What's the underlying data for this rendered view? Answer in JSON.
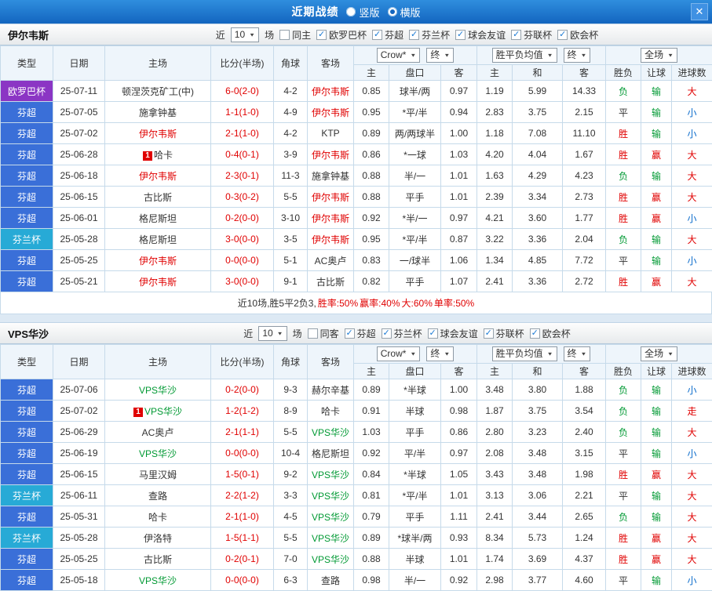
{
  "topbar": {
    "title": "近期战绩",
    "layout_options": [
      {
        "label": "竖版",
        "selected": false
      },
      {
        "label": "横版",
        "selected": true
      }
    ]
  },
  "icons": {
    "check": "✓",
    "dropdown_arrow": "▼",
    "close": "✕"
  },
  "columns": {
    "main": [
      "类型",
      "日期",
      "主场",
      "比分(半场)",
      "角球",
      "客场"
    ],
    "sub": [
      "主",
      "盘口",
      "客",
      "主",
      "和",
      "客",
      "胜负",
      "让球",
      "进球数"
    ],
    "odds_source": "Crow*",
    "odds_final": "终",
    "avg_label": "胜平负均值",
    "avg_final": "终",
    "scope": "全场"
  },
  "colors": {
    "score": "#e00000",
    "type": {
      "欧罗巴杯": "#8b35c4",
      "芬超": "#3a6fd8",
      "芬兰杯": "#27aad6"
    },
    "result": {
      "胜": "#e00000",
      "赢": "#e00000",
      "大": "#e00000",
      "走": "#e00000",
      "负": "#009933",
      "输": "#009933",
      "平": "#333333",
      "小": "#0b6bcb"
    }
  },
  "sections": [
    {
      "team": "伊尔韦斯",
      "focus_color": "#e00000",
      "filter": {
        "near": "近",
        "count": "10",
        "unit": "场",
        "venue": {
          "label": "同主",
          "checked": false
        },
        "competitions": [
          {
            "label": "欧罗巴杯",
            "checked": true
          },
          {
            "label": "芬超",
            "checked": true
          },
          {
            "label": "芬兰杯",
            "checked": true
          },
          {
            "label": "球会友谊",
            "checked": true
          },
          {
            "label": "芬联杯",
            "checked": true
          },
          {
            "label": "欧会杯",
            "checked": true
          }
        ]
      },
      "rows": [
        {
          "type": "欧罗巴杯",
          "date": "25-07-11",
          "home": "顿涅茨克矿工(中)",
          "score": "6-0(2-0)",
          "corner": "4-2",
          "away": "伊尔韦斯",
          "away_focus": true,
          "odds": [
            "0.85",
            "球半/两",
            "0.97"
          ],
          "avg": [
            "1.19",
            "5.99",
            "14.33"
          ],
          "res": [
            "负",
            "输",
            "大"
          ]
        },
        {
          "type": "芬超",
          "date": "25-07-05",
          "home": "施拿钟基",
          "score": "1-1(1-0)",
          "corner": "4-9",
          "away": "伊尔韦斯",
          "away_focus": true,
          "odds": [
            "0.95",
            "*平/半",
            "0.94"
          ],
          "avg": [
            "2.83",
            "3.75",
            "2.15"
          ],
          "res": [
            "平",
            "输",
            "小"
          ]
        },
        {
          "type": "芬超",
          "date": "25-07-02",
          "home": "伊尔韦斯",
          "home_focus": true,
          "score": "2-1(1-0)",
          "corner": "4-2",
          "away": "KTP",
          "odds": [
            "0.89",
            "两/两球半",
            "1.00"
          ],
          "avg": [
            "1.18",
            "7.08",
            "11.10"
          ],
          "res": [
            "胜",
            "输",
            "小"
          ]
        },
        {
          "type": "芬超",
          "date": "25-06-28",
          "home": "哈卡",
          "home_badge": "1",
          "score": "0-4(0-1)",
          "corner": "3-9",
          "away": "伊尔韦斯",
          "away_focus": true,
          "odds": [
            "0.86",
            "*一球",
            "1.03"
          ],
          "avg": [
            "4.20",
            "4.04",
            "1.67"
          ],
          "res": [
            "胜",
            "赢",
            "大"
          ]
        },
        {
          "type": "芬超",
          "date": "25-06-18",
          "home": "伊尔韦斯",
          "home_focus": true,
          "score": "2-3(0-1)",
          "corner": "11-3",
          "away": "施拿钟基",
          "odds": [
            "0.88",
            "半/一",
            "1.01"
          ],
          "avg": [
            "1.63",
            "4.29",
            "4.23"
          ],
          "res": [
            "负",
            "输",
            "大"
          ]
        },
        {
          "type": "芬超",
          "date": "25-06-15",
          "home": "古比斯",
          "score": "0-3(0-2)",
          "corner": "5-5",
          "away": "伊尔韦斯",
          "away_focus": true,
          "odds": [
            "0.88",
            "平手",
            "1.01"
          ],
          "avg": [
            "2.39",
            "3.34",
            "2.73"
          ],
          "res": [
            "胜",
            "赢",
            "大"
          ]
        },
        {
          "type": "芬超",
          "date": "25-06-01",
          "home": "格尼斯坦",
          "score": "0-2(0-0)",
          "corner": "3-10",
          "away": "伊尔韦斯",
          "away_focus": true,
          "odds": [
            "0.92",
            "*半/一",
            "0.97"
          ],
          "avg": [
            "4.21",
            "3.60",
            "1.77"
          ],
          "res": [
            "胜",
            "赢",
            "小"
          ]
        },
        {
          "type": "芬兰杯",
          "date": "25-05-28",
          "home": "格尼斯坦",
          "score": "3-0(0-0)",
          "corner": "3-5",
          "away": "伊尔韦斯",
          "away_focus": true,
          "odds": [
            "0.95",
            "*平/半",
            "0.87"
          ],
          "avg": [
            "3.22",
            "3.36",
            "2.04"
          ],
          "res": [
            "负",
            "输",
            "大"
          ]
        },
        {
          "type": "芬超",
          "date": "25-05-25",
          "home": "伊尔韦斯",
          "home_focus": true,
          "score": "0-0(0-0)",
          "corner": "5-1",
          "away": "AC奥卢",
          "odds": [
            "0.83",
            "一/球半",
            "1.06"
          ],
          "avg": [
            "1.34",
            "4.85",
            "7.72"
          ],
          "res": [
            "平",
            "输",
            "小"
          ]
        },
        {
          "type": "芬超",
          "date": "25-05-21",
          "home": "伊尔韦斯",
          "home_focus": true,
          "score": "3-0(0-0)",
          "corner": "9-1",
          "away": "古比斯",
          "odds": [
            "0.82",
            "平手",
            "1.07"
          ],
          "avg": [
            "2.41",
            "3.36",
            "2.72"
          ],
          "res": [
            "胜",
            "赢",
            "大"
          ]
        }
      ],
      "summary": [
        {
          "text": "近10场,胜5平2负3, ",
          "color": "#333333"
        },
        {
          "text": "胜率:50% ",
          "color": "#e00000"
        },
        {
          "text": "赢率:40% ",
          "color": "#e00000"
        },
        {
          "text": "大:60% ",
          "color": "#e00000"
        },
        {
          "text": "单率:50%",
          "color": "#e00000"
        }
      ]
    },
    {
      "team": "VPS华沙",
      "focus_color": "#009933",
      "filter": {
        "near": "近",
        "count": "10",
        "unit": "场",
        "venue": {
          "label": "同客",
          "checked": false
        },
        "competitions": [
          {
            "label": "芬超",
            "checked": true
          },
          {
            "label": "芬兰杯",
            "checked": true
          },
          {
            "label": "球会友谊",
            "checked": true
          },
          {
            "label": "芬联杯",
            "checked": true
          },
          {
            "label": "欧会杯",
            "checked": true
          }
        ]
      },
      "rows": [
        {
          "type": "芬超",
          "date": "25-07-06",
          "home": "VPS华沙",
          "home_focus": true,
          "score": "0-2(0-0)",
          "corner": "9-3",
          "away": "赫尔辛基",
          "odds": [
            "0.89",
            "*半球",
            "1.00"
          ],
          "avg": [
            "3.48",
            "3.80",
            "1.88"
          ],
          "res": [
            "负",
            "输",
            "小"
          ]
        },
        {
          "type": "芬超",
          "date": "25-07-02",
          "home": "VPS华沙",
          "home_focus": true,
          "home_badge": "1",
          "score": "1-2(1-2)",
          "corner": "8-9",
          "away": "哈卡",
          "odds": [
            "0.91",
            "半球",
            "0.98"
          ],
          "avg": [
            "1.87",
            "3.75",
            "3.54"
          ],
          "res": [
            "负",
            "输",
            "走"
          ]
        },
        {
          "type": "芬超",
          "date": "25-06-29",
          "home": "AC奥卢",
          "score": "2-1(1-1)",
          "corner": "5-5",
          "away": "VPS华沙",
          "away_focus": true,
          "odds": [
            "1.03",
            "平手",
            "0.86"
          ],
          "avg": [
            "2.80",
            "3.23",
            "2.40"
          ],
          "res": [
            "负",
            "输",
            "大"
          ]
        },
        {
          "type": "芬超",
          "date": "25-06-19",
          "home": "VPS华沙",
          "home_focus": true,
          "score": "0-0(0-0)",
          "corner": "10-4",
          "away": "格尼斯坦",
          "odds": [
            "0.92",
            "平/半",
            "0.97"
          ],
          "avg": [
            "2.08",
            "3.48",
            "3.15"
          ],
          "res": [
            "平",
            "输",
            "小"
          ]
        },
        {
          "type": "芬超",
          "date": "25-06-15",
          "home": "马里汉姆",
          "score": "1-5(0-1)",
          "corner": "9-2",
          "away": "VPS华沙",
          "away_focus": true,
          "odds": [
            "0.84",
            "*半球",
            "1.05"
          ],
          "avg": [
            "3.43",
            "3.48",
            "1.98"
          ],
          "res": [
            "胜",
            "赢",
            "大"
          ]
        },
        {
          "type": "芬兰杯",
          "date": "25-06-11",
          "home": "查路",
          "score": "2-2(1-2)",
          "corner": "3-3",
          "away": "VPS华沙",
          "away_focus": true,
          "odds": [
            "0.81",
            "*平/半",
            "1.01"
          ],
          "avg": [
            "3.13",
            "3.06",
            "2.21"
          ],
          "res": [
            "平",
            "输",
            "大"
          ]
        },
        {
          "type": "芬超",
          "date": "25-05-31",
          "home": "哈卡",
          "score": "2-1(1-0)",
          "corner": "4-5",
          "away": "VPS华沙",
          "away_focus": true,
          "odds": [
            "0.79",
            "平手",
            "1.11"
          ],
          "avg": [
            "2.41",
            "3.44",
            "2.65"
          ],
          "res": [
            "负",
            "输",
            "大"
          ]
        },
        {
          "type": "芬兰杯",
          "date": "25-05-28",
          "home": "伊洛特",
          "score": "1-5(1-1)",
          "corner": "5-5",
          "away": "VPS华沙",
          "away_focus": true,
          "odds": [
            "0.89",
            "*球半/两",
            "0.93"
          ],
          "avg": [
            "8.34",
            "5.73",
            "1.24"
          ],
          "res": [
            "胜",
            "赢",
            "大"
          ]
        },
        {
          "type": "芬超",
          "date": "25-05-25",
          "home": "古比斯",
          "score": "0-2(0-1)",
          "corner": "7-0",
          "away": "VPS华沙",
          "away_focus": true,
          "odds": [
            "0.88",
            "半球",
            "1.01"
          ],
          "avg": [
            "1.74",
            "3.69",
            "4.37"
          ],
          "res": [
            "胜",
            "赢",
            "大"
          ]
        },
        {
          "type": "芬超",
          "date": "25-05-18",
          "home": "VPS华沙",
          "home_focus": true,
          "score": "0-0(0-0)",
          "corner": "6-3",
          "away": "查路",
          "odds": [
            "0.98",
            "半/一",
            "0.92"
          ],
          "avg": [
            "2.98",
            "3.77",
            "4.60"
          ],
          "res": [
            "平",
            "输",
            "小"
          ]
        }
      ]
    }
  ]
}
